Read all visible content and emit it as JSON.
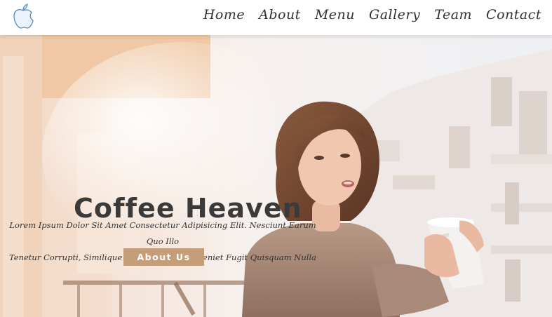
{
  "nav": {
    "logo_icon": "apple-logo-icon",
    "links": [
      "Home",
      "About",
      "Menu",
      "Gallery",
      "Team",
      "Contact"
    ]
  },
  "hero": {
    "title": "Coffee Heaven",
    "text_line1": "Lorem Ipsum Dolor Sit Amet Consectetur Adipisicing Elit. Nesciunt Earum Quo Illo",
    "text_line2": "Tenetur Corrupti, Similique Laudantium Est Eveniet Fugit Quisquam Nulla",
    "button_label": "About Us"
  },
  "colors": {
    "button": "#c59d78",
    "title": "#3a3a3a",
    "nav_text": "#333333"
  }
}
